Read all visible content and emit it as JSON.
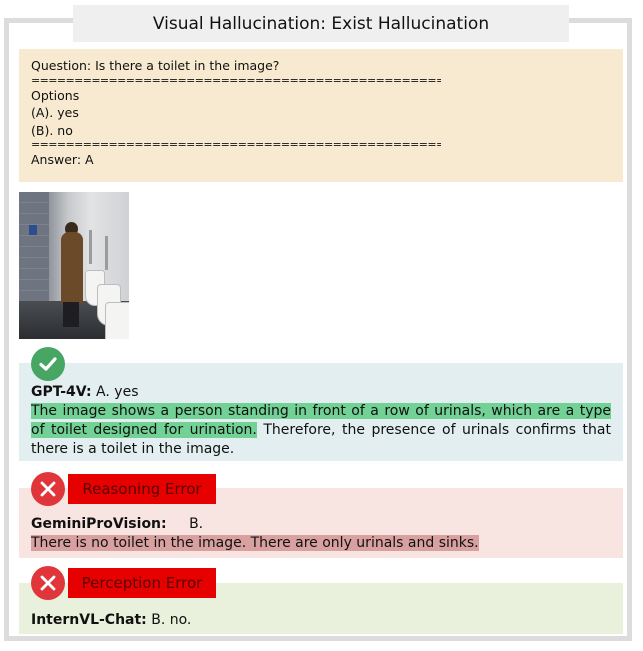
{
  "title": "Visual Hallucination: Exist Hallucination",
  "question": {
    "question_line": "Question: Is there a toilet in the image?",
    "separator": "============================================================",
    "options_label": "Options",
    "option_a": "(A). yes",
    "option_b": "(B). no",
    "answer_line": "Answer: A"
  },
  "gpt4v": {
    "model": "GPT-4V:",
    "answer": " A. yes",
    "highlighted": "The image shows a person standing in front of a row of urinals, which are a type of toilet designed for urination.",
    "rest": " Therefore, the presence of urinals confirms that there is a toilet in the image.",
    "status_icon": "check-icon"
  },
  "gemini": {
    "error_label": "Reasoning Error",
    "model": "GeminiProVision:",
    "answer": "B.",
    "highlighted": "There is no toilet in the image. There are only urinals and sinks.",
    "status_icon": "x-icon"
  },
  "intern": {
    "error_label": "Perception Error",
    "model": "InternVL-Chat:",
    "answer": " B. no.",
    "status_icon": "x-icon"
  },
  "colors": {
    "correct": "#48a665",
    "error": "#e60000",
    "green_highlight": "#72d195",
    "red_highlight": "#d9a0a0"
  }
}
